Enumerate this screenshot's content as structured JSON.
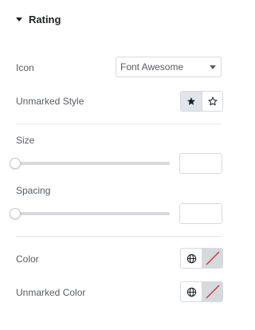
{
  "section": {
    "title": "Rating"
  },
  "icon": {
    "label": "Icon",
    "selected": "Font Awesome"
  },
  "unmarked_style": {
    "label": "Unmarked Style",
    "options": [
      "solid-star-icon",
      "outline-star-icon"
    ],
    "active": "solid-star-icon"
  },
  "size": {
    "label": "Size",
    "value": "",
    "slider_fraction": 0
  },
  "spacing": {
    "label": "Spacing",
    "value": "",
    "slider_fraction": 0
  },
  "color": {
    "label": "Color"
  },
  "unmarked_color": {
    "label": "Unmarked Color"
  },
  "colors": {
    "swatch_empty": "#d5dadf",
    "slash": "#d63638",
    "active_bg": "#e1e4e8"
  }
}
